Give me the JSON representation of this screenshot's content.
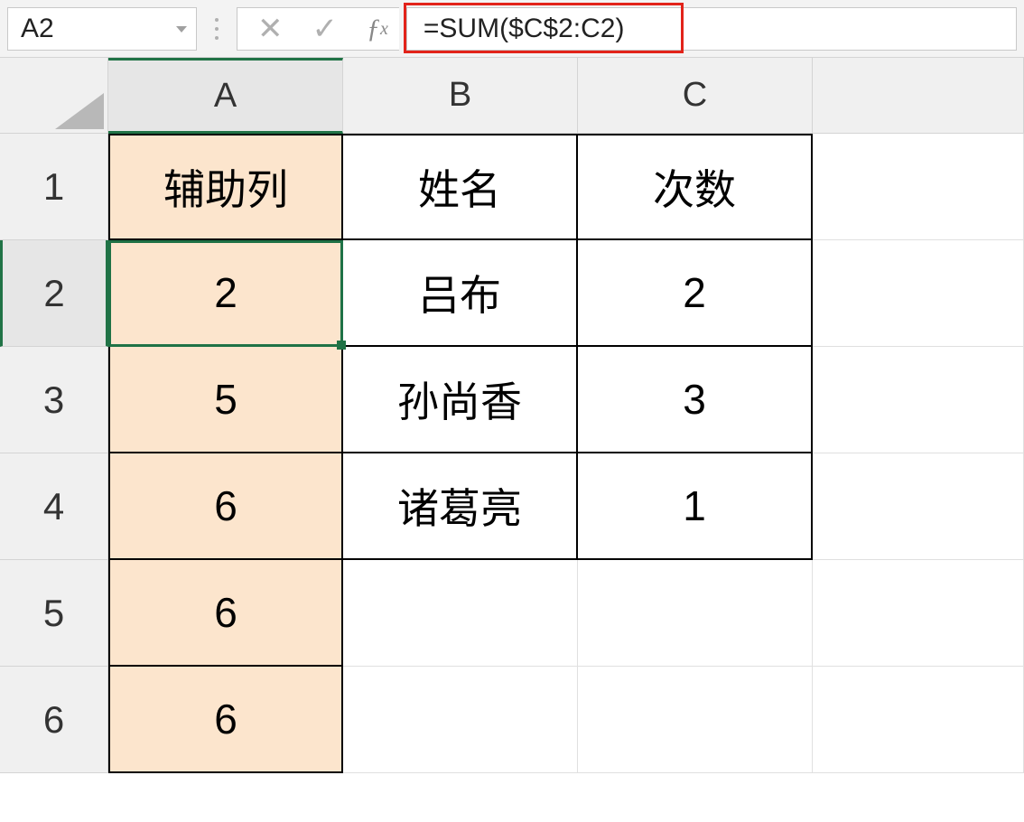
{
  "formula_bar": {
    "name_box": "A2",
    "cancel_icon": "✕",
    "accept_icon": "✓",
    "fx_label": "ƒx",
    "formula": "=SUM($C$2:C2)"
  },
  "columns": [
    "A",
    "B",
    "C"
  ],
  "rows": [
    "1",
    "2",
    "3",
    "4",
    "5",
    "6"
  ],
  "cells": {
    "A1": "辅助列",
    "B1": "姓名",
    "C1": "次数",
    "A2": "2",
    "B2": "吕布",
    "C2": "2",
    "A3": "5",
    "B3": "孙尚香",
    "C3": "3",
    "A4": "6",
    "B4": "诸葛亮",
    "C4": "1",
    "A5": "6",
    "A6": "6"
  },
  "highlight_cell": "A2",
  "highlight_formula_color": "#e2231a"
}
